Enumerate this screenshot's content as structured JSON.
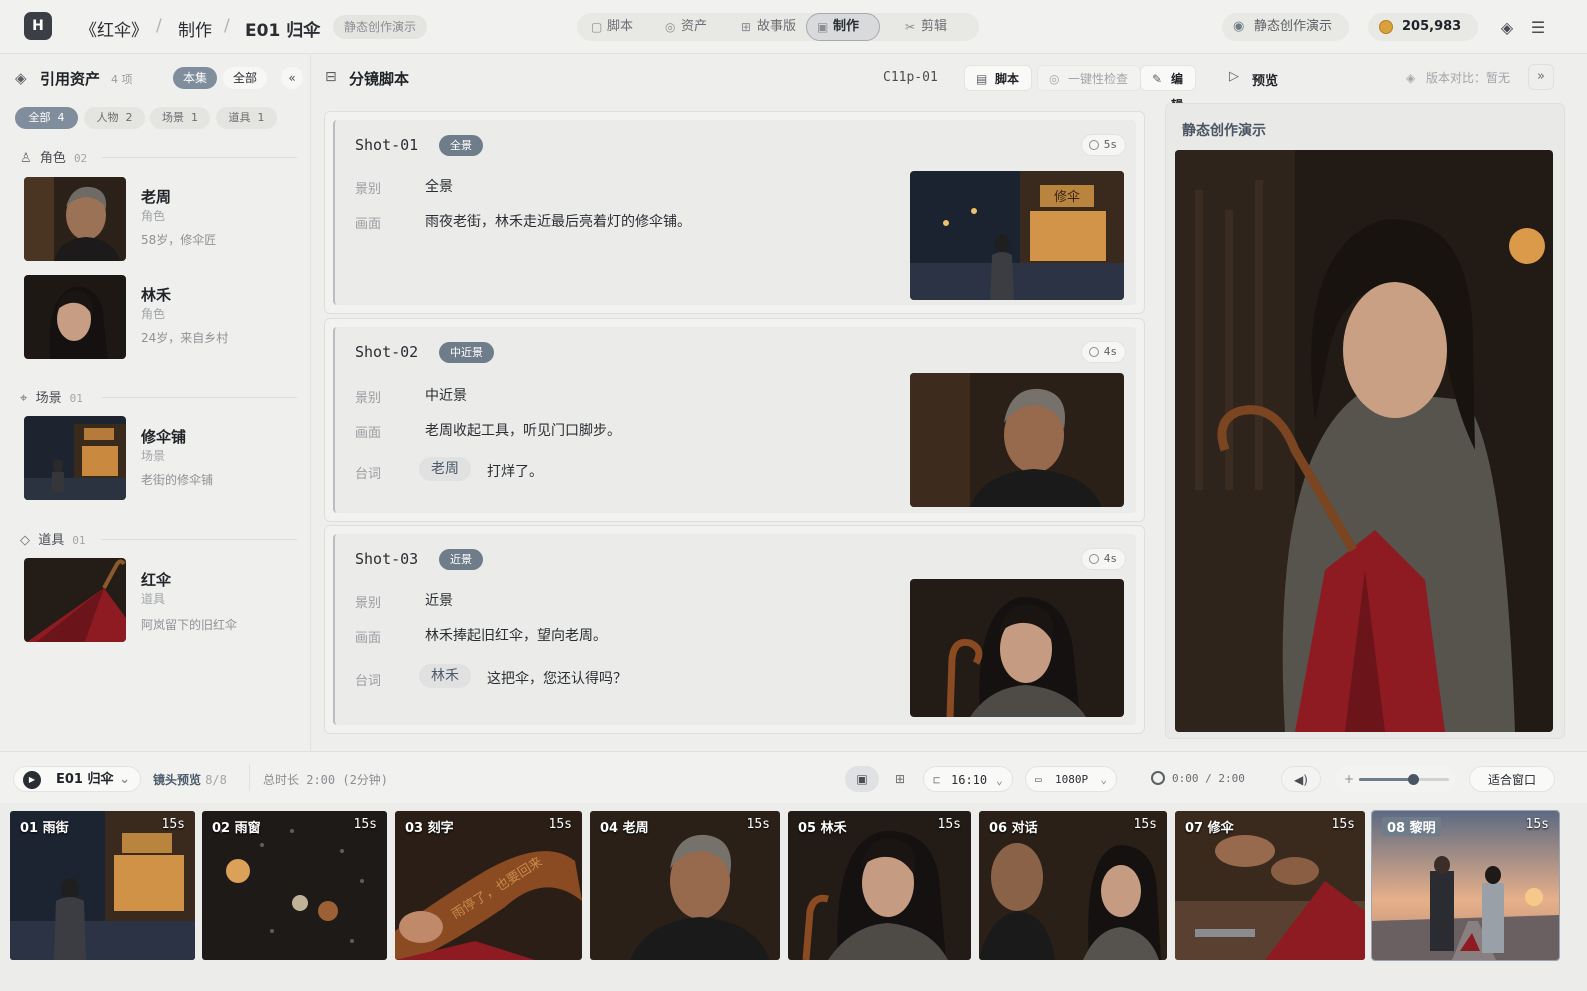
{
  "topbar": {
    "logo": "H",
    "project": "《红伞》",
    "section": "制作",
    "episode": "E01 归伞",
    "demo_tag": "静态创作演示",
    "tabs": [
      {
        "label": "脚本",
        "icon": "doc-icon"
      },
      {
        "label": "资产",
        "icon": "asset-icon"
      },
      {
        "label": "故事版",
        "icon": "grid-icon"
      },
      {
        "label": "制作",
        "icon": "production-icon",
        "active": true
      },
      {
        "label": "剪辑",
        "icon": "scissors-icon"
      }
    ],
    "mode_label": "静态创作演示",
    "credits": "205,983"
  },
  "assets": {
    "title": "引用资产",
    "count": "4 项",
    "scope_current": "本集",
    "scope_all": "全部",
    "filters": [
      {
        "label": "全部",
        "count": "4",
        "active": true
      },
      {
        "label": "人物",
        "count": "2"
      },
      {
        "label": "场景",
        "count": "1"
      },
      {
        "label": "道具",
        "count": "1"
      }
    ],
    "sections": {
      "characters": {
        "label": "角色",
        "count": "02"
      },
      "scenes": {
        "label": "场景",
        "count": "01"
      },
      "props": {
        "label": "道具",
        "count": "01"
      }
    },
    "items": {
      "laozhou": {
        "name": "老周",
        "type": "角色",
        "desc": "58岁，修伞匠"
      },
      "linhe": {
        "name": "林禾",
        "type": "角色",
        "desc": "24岁，来自乡村"
      },
      "shop": {
        "name": "修伞铺",
        "type": "场景",
        "desc": "老街的修伞铺"
      },
      "umbrella": {
        "name": "红伞",
        "type": "道具",
        "desc": "阿岚留下的旧红伞"
      }
    }
  },
  "script": {
    "title": "分镜脚本",
    "clip_id": "C11p-01",
    "btn_script": "脚本",
    "btn_check": "一键性检查",
    "btn_edit": "编辑",
    "labels": {
      "framing": "景别",
      "frame": "画面",
      "dialogue": "台词"
    },
    "shots": [
      {
        "id": "Shot-01",
        "badge": "全景",
        "duration": "5s",
        "framing": "全景",
        "frame": "雨夜老街，林禾走近最后亮着灯的修伞铺。"
      },
      {
        "id": "Shot-02",
        "badge": "中近景",
        "duration": "4s",
        "framing": "中近景",
        "frame": "老周收起工具，听见门口脚步。",
        "speaker": "老周",
        "line": "打烊了。"
      },
      {
        "id": "Shot-03",
        "badge": "近景",
        "duration": "4s",
        "framing": "近景",
        "frame": "林禾捧起旧红伞，望向老周。",
        "speaker": "林禾",
        "line": "这把伞，您还认得吗？"
      }
    ]
  },
  "preview": {
    "label": "预览",
    "version": "版本对比：暂无",
    "card_title": "静态创作演示"
  },
  "player": {
    "episode": "E01 归伞",
    "shots_label": "镜头预览",
    "shots_count": "8/8",
    "total": "总时长 2:00 (2分钟)",
    "ratio": "16:10",
    "resolution": "1080P",
    "time": "0:00 / 2:00",
    "volume": 0.6,
    "fit": "适合窗口"
  },
  "filmstrip": [
    {
      "label": "01 雨街",
      "duration": "15s"
    },
    {
      "label": "02 雨窗",
      "duration": "15s"
    },
    {
      "label": "03 刻字",
      "duration": "15s",
      "engraving": "雨停了，也要回来"
    },
    {
      "label": "04 老周",
      "duration": "15s"
    },
    {
      "label": "05 林禾",
      "duration": "15s"
    },
    {
      "label": "06 对话",
      "duration": "15s"
    },
    {
      "label": "07 修伞",
      "duration": "15s"
    },
    {
      "label": "08 黎明",
      "duration": "15s",
      "highlight": true
    }
  ],
  "shop_sign": "修伞",
  "colors": {
    "accent": "#7f8d9c",
    "umbrella_red": "#8e1b22",
    "warm_light": "#f0a850"
  }
}
